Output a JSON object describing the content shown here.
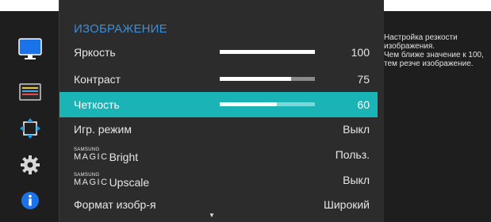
{
  "menu": {
    "title": "ИЗОБРАЖЕНИЕ",
    "items": [
      {
        "label": "Яркость",
        "value": "100",
        "level": 1.0
      },
      {
        "label": "Контраст",
        "value": "75",
        "level": 0.75
      },
      {
        "label": "Четкость",
        "value": "60",
        "level": 0.6,
        "selected": true
      },
      {
        "label": "Игр. режим",
        "value": "Выкл"
      },
      {
        "magic_top": "SAMSUNG",
        "magic_bottom": "MAGIC",
        "label": "Bright",
        "value": "Польз."
      },
      {
        "magic_top": "SAMSUNG",
        "magic_bottom": "MAGIC",
        "label": "Upscale",
        "value": "Выкл"
      },
      {
        "label": "Формат изобр-я",
        "value": "Широкий"
      }
    ],
    "scroll_indicator": "▼"
  },
  "help": {
    "text": "Настройка резкости изображения.\nЧем ближе значение к 100, тем резче изображение."
  },
  "sidebar": {
    "icons": [
      "monitor-icon",
      "color-settings-icon",
      "size-position-icon",
      "gear-icon",
      "info-icon"
    ],
    "active": "monitor-icon"
  },
  "colors": {
    "accent_title": "#3a8fdc",
    "selection": "#1ab3b6",
    "active_icon": "#1a73e8"
  }
}
